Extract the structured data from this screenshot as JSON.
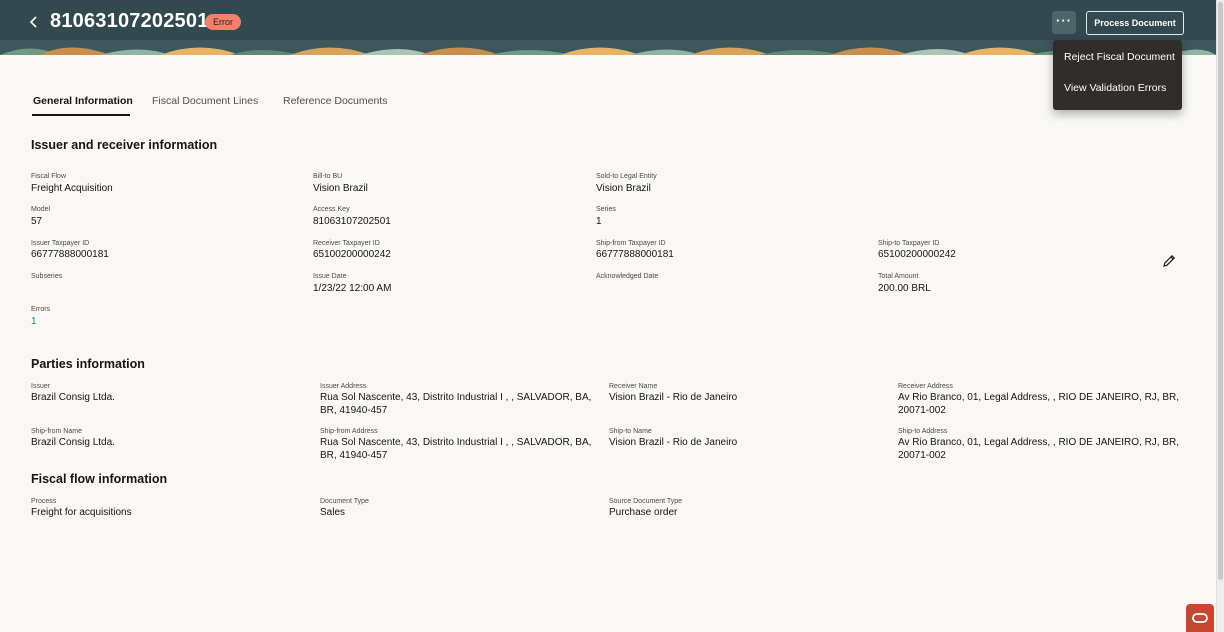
{
  "header": {
    "title": "81063107202501",
    "status_badge": "Error",
    "more_label": "···",
    "process_button": "Process Document"
  },
  "menu": {
    "items": [
      "Reject Fiscal Document",
      "View Validation Errors"
    ]
  },
  "tabs": [
    "General Information",
    "Fiscal Document Lines",
    "Reference Documents"
  ],
  "issuer_receiver": {
    "title": "Issuer and receiver information",
    "fiscal_flow": {
      "label": "Fiscal Flow",
      "value": "Freight Acquisition"
    },
    "bill_to_bu": {
      "label": "Bill-to BU",
      "value": "Vision Brazil"
    },
    "sold_to_legal_entity": {
      "label": "Sold-to Legal Entity",
      "value": "Vision Brazil"
    },
    "model": {
      "label": "Model",
      "value": "57"
    },
    "access_key": {
      "label": "Access Key",
      "value": "81063107202501"
    },
    "series": {
      "label": "Series",
      "value": "1"
    },
    "issuer_taxpayer_id": {
      "label": "Issuer Taxpayer ID",
      "value": "66777888000181"
    },
    "receiver_taxpayer_id": {
      "label": "Receiver Taxpayer ID",
      "value": "65100200000242"
    },
    "ship_from_taxpayer_id": {
      "label": "Ship-from Taxpayer ID",
      "value": "66777888000181"
    },
    "ship_to_taxpayer_id": {
      "label": "Ship-to Taxpayer ID",
      "value": "65100200000242"
    },
    "subseries": {
      "label": "Subseries",
      "value": ""
    },
    "issue_date": {
      "label": "Issue Date",
      "value": "1/23/22 12:00 AM"
    },
    "acknowledged_date": {
      "label": "Acknowledged Date",
      "value": ""
    },
    "total_amount": {
      "label": "Total Amount",
      "value": "200.00 BRL"
    },
    "errors": {
      "label": "Errors",
      "value": "1"
    }
  },
  "parties": {
    "title": "Parties information",
    "issuer": {
      "label": "Issuer",
      "value": "Brazil Consig Ltda."
    },
    "issuer_address": {
      "label": "Issuer Address",
      "value": "Rua Sol Nascente, 43, Distrito Industrial I , , SALVADOR, BA, BR, 41940-457"
    },
    "receiver_name": {
      "label": "Receiver Name",
      "value": "Vision Brazil - Rio de Janeiro"
    },
    "receiver_address": {
      "label": "Receiver Address",
      "value": "Av Rio Branco, 01, Legal Address, , RIO DE JANEIRO, RJ, BR, 20071-002"
    },
    "ship_from_name": {
      "label": "Ship-from Name",
      "value": "Brazil Consig Ltda."
    },
    "ship_from_address": {
      "label": "Ship-from Address",
      "value": "Rua Sol Nascente, 43, Distrito Industrial I , , SALVADOR, BA, BR, 41940-457"
    },
    "ship_to_name": {
      "label": "Ship-to Name",
      "value": "Vision Brazil - Rio de Janeiro"
    },
    "ship_to_address": {
      "label": "Ship-to Address",
      "value": "Av Rio Branco, 01, Legal Address, , RIO DE JANEIRO, RJ, BR, 20071-002"
    }
  },
  "fiscal_flow_info": {
    "title": "Fiscal flow information",
    "process": {
      "label": "Process",
      "value": "Freight for acquisitions"
    },
    "document_type": {
      "label": "Document Type",
      "value": "Sales"
    },
    "source_document_type": {
      "label": "Source Document Type",
      "value": "Purchase order"
    }
  },
  "icons": {
    "back": "chevron-left-icon",
    "edit": "pencil-icon",
    "oracle": "oracle-logo-icon"
  },
  "colors": {
    "header_bg": "#31494f",
    "error_badge": "#f0826c",
    "menu_bg": "#312d2a",
    "link": "#227e9e",
    "oracle_red": "#c74634"
  }
}
